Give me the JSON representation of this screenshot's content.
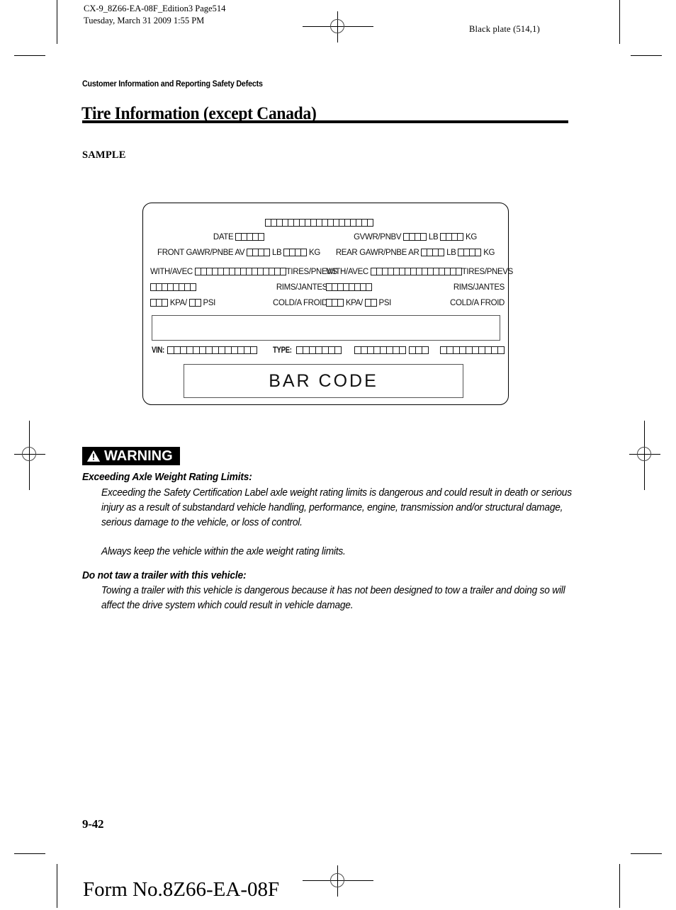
{
  "document": {
    "running_head_line1": "CX-9_8Z66-EA-08F_Edition3 Page514",
    "running_head_line2": "Tuesday, March 31 2009 1:55 PM",
    "black_plate": "Black plate (514,1)",
    "chapter_label": "Customer Information and Reporting Safety Defects",
    "page_title": "Tire Information (except Canada)",
    "sample_caption": "SAMPLE",
    "folio": "9-42",
    "form_number": "Form No.8Z66-EA-08F"
  },
  "cert_label": {
    "top_boxes": 19,
    "left_column": [
      {
        "id": "date",
        "segments": [
          {
            "type": "text",
            "value": "DATE"
          },
          {
            "type": "boxes",
            "count": 5
          }
        ]
      },
      {
        "id": "front-gawr",
        "segments": [
          {
            "type": "text",
            "value": "FRONT GAWR/PNBE AV"
          },
          {
            "type": "boxes",
            "count": 4
          },
          {
            "type": "text",
            "value": "LB"
          },
          {
            "type": "boxes",
            "count": 4
          },
          {
            "type": "text",
            "value": "KG"
          }
        ]
      },
      {
        "id": "front-tires",
        "left_text": "WITH/AVEC",
        "boxes": 16,
        "right_text": "TIRES/PNEVS"
      },
      {
        "id": "front-rims",
        "left_text": "",
        "boxes": 8,
        "right_text": "RIMS/JANTES"
      },
      {
        "id": "front-pressure",
        "segments": [
          {
            "type": "boxes",
            "count": 3
          },
          {
            "type": "text",
            "value": "KPA/"
          },
          {
            "type": "boxes",
            "count": 2
          },
          {
            "type": "text",
            "value": "PSI"
          }
        ],
        "right_text": "COLD/A FROID"
      }
    ],
    "right_column": [
      {
        "id": "gvwr",
        "segments": [
          {
            "type": "text",
            "value": "GVWR/PNBV"
          },
          {
            "type": "boxes",
            "count": 4
          },
          {
            "type": "text",
            "value": "LB"
          },
          {
            "type": "boxes",
            "count": 4
          },
          {
            "type": "text",
            "value": "KG"
          }
        ]
      },
      {
        "id": "rear-gawr",
        "segments": [
          {
            "type": "text",
            "value": "REAR GAWR/PNBE AR"
          },
          {
            "type": "boxes",
            "count": 4
          },
          {
            "type": "text",
            "value": "LB"
          },
          {
            "type": "boxes",
            "count": 4
          },
          {
            "type": "text",
            "value": "KG"
          }
        ]
      },
      {
        "id": "rear-tires",
        "left_text": "WITH/AVEC",
        "boxes": 16,
        "right_text": "TIRES/PNEVS"
      },
      {
        "id": "rear-rims",
        "left_text": "",
        "boxes": 8,
        "right_text": "RIMS/JANTES"
      },
      {
        "id": "rear-pressure",
        "segments": [
          {
            "type": "boxes",
            "count": 3
          },
          {
            "type": "text",
            "value": "KPA/"
          },
          {
            "type": "boxes",
            "count": 2
          },
          {
            "type": "text",
            "value": "PSI"
          }
        ],
        "right_text": "COLD/A FROID"
      }
    ],
    "vin_row": {
      "vin_label": "VIN:",
      "vin_boxes": 14,
      "type_label": "TYPE:",
      "type_boxes": 7,
      "extra_group_1_boxes": 8,
      "extra_group_2_boxes": 3,
      "extra_group_3_boxes": 10
    },
    "barcode_text": "BAR CODE"
  },
  "warning": {
    "banner_label": "WARNING",
    "banner_icon": "warning-triangle-icon",
    "sections": [
      {
        "heading": "Exceeding Axle Weight Rating Limits:",
        "body": "Exceeding the Safety Certification Label axle weight rating limits is dangerous and could result in death or serious injury as a result of substandard vehicle handling, performance, engine, transmission and/or structural damage, serious damage to the vehicle, or loss of control.",
        "extra": "Always keep the vehicle within the axle weight rating limits."
      },
      {
        "heading": "Do not taw a trailer with this vehicle:",
        "body": "Towing a trailer with this vehicle is dangerous because it has not been designed to tow a trailer and doing so will affect the drive system which could result in vehicle damage."
      }
    ]
  },
  "colors": {
    "ink": "#000000",
    "paper": "#ffffff",
    "rule": "#000000",
    "box_outline": "#555555"
  }
}
